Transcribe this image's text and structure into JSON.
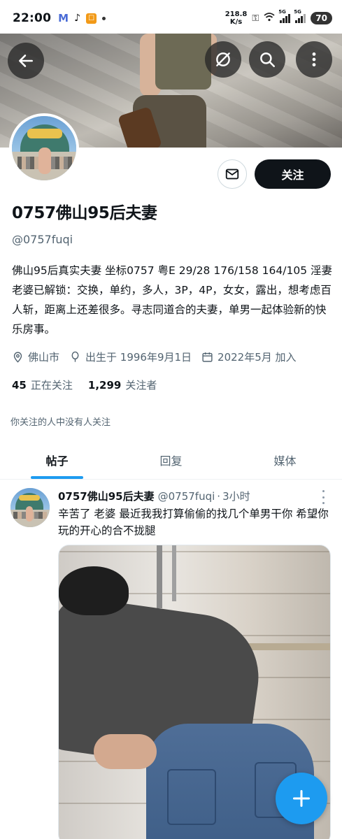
{
  "status_bar": {
    "time": "22:00",
    "net_speed_value": "218.8",
    "net_speed_unit": "K/s",
    "signal_1": "5G",
    "signal_2": "5G",
    "battery": "70",
    "app_icons": [
      "m-app-icon",
      "tiktok-icon",
      "orange-app-icon"
    ]
  },
  "profile": {
    "display_name": "0757佛山95后夫妻",
    "handle": "@0757fuqi",
    "bio": "佛山95后真实夫妻 坐标0757 粤E 29/28 176/158 164/105 淫妻 老婆已解锁：交换，单约，多人，3P，4P，女女，露出，想考虑百人斩，距离上还差很多。寻志同道合的夫妻，单男一起体验新的快乐房事。",
    "location": "佛山市",
    "birthday": "出生于 1996年9月1日",
    "joined": "2022年5月 加入",
    "following_count": "45",
    "following_label": "正在关注",
    "followers_count": "1,299",
    "followers_label": "关注者",
    "followed_by_note": "你关注的人中没有人关注",
    "follow_label": "关注"
  },
  "tabs": [
    {
      "label": "帖子",
      "active": true
    },
    {
      "label": "回复",
      "active": false
    },
    {
      "label": "媒体",
      "active": false
    }
  ],
  "post": {
    "name": "0757佛山95后夫妻",
    "handle": "@0757fuqi",
    "separator": "·",
    "time": "3小时",
    "text": "辛苦了 老婆 最近我我打算偷偷的找几个单男干你 希望你玩的开心的合不拢腿"
  },
  "colors": {
    "accent": "#1d9bf0",
    "text_primary": "#0f1419",
    "text_secondary": "#536471",
    "follow_button": "#0f1419"
  }
}
